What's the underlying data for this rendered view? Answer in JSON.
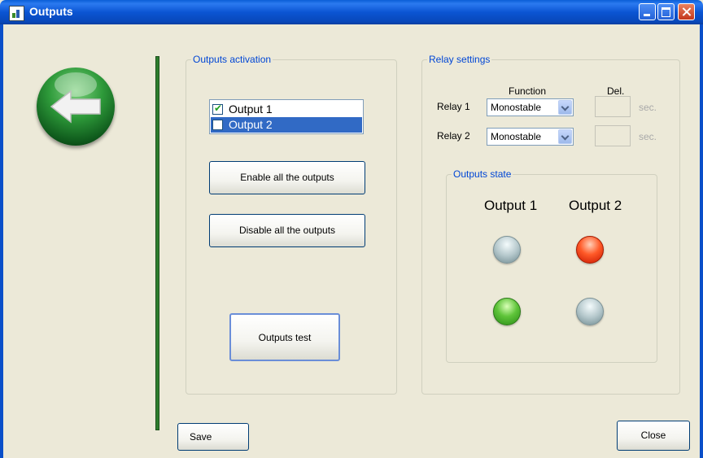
{
  "window": {
    "title": "Outputs",
    "buttons": {
      "minimize": "minimize-icon",
      "maximize": "maximize-icon",
      "close": "close-icon"
    }
  },
  "back_button": {
    "icon": "back-arrow-icon"
  },
  "outputs_activation": {
    "legend": "Outputs activation",
    "list": [
      {
        "label": "Output 1",
        "checked": true,
        "selected": false
      },
      {
        "label": "Output 2",
        "checked": false,
        "selected": true
      }
    ],
    "enable_all_label": "Enable all the outputs",
    "disable_all_label": "Disable all the outputs",
    "test_label": "Outputs test"
  },
  "relay_settings": {
    "legend": "Relay settings",
    "function_header": "Function",
    "delay_header": "Del.",
    "relays": [
      {
        "label": "Relay 1",
        "function": "Monostable",
        "delay": "",
        "unit": "sec."
      },
      {
        "label": "Relay 2",
        "function": "Monostable",
        "delay": "",
        "unit": "sec."
      }
    ]
  },
  "outputs_state": {
    "legend": "Outputs state",
    "columns": [
      "Output 1",
      "Output 2"
    ],
    "leds": [
      {
        "column": "Output 1",
        "color": "gray",
        "hex": "#b5c8cc"
      },
      {
        "column": "Output 2",
        "color": "red",
        "hex": "#ff5a28"
      },
      {
        "column": "Output 1",
        "color": "green",
        "hex": "#5fc43a"
      },
      {
        "column": "Output 2",
        "color": "gray",
        "hex": "#b5c8cc"
      }
    ]
  },
  "footer": {
    "save_label": "Save",
    "close_label": "Close"
  },
  "colors": {
    "titlebar": "#0b55d3",
    "legend_text": "#0046d5",
    "window_bg": "#ece9d8",
    "divider": "#2d7d2d"
  }
}
